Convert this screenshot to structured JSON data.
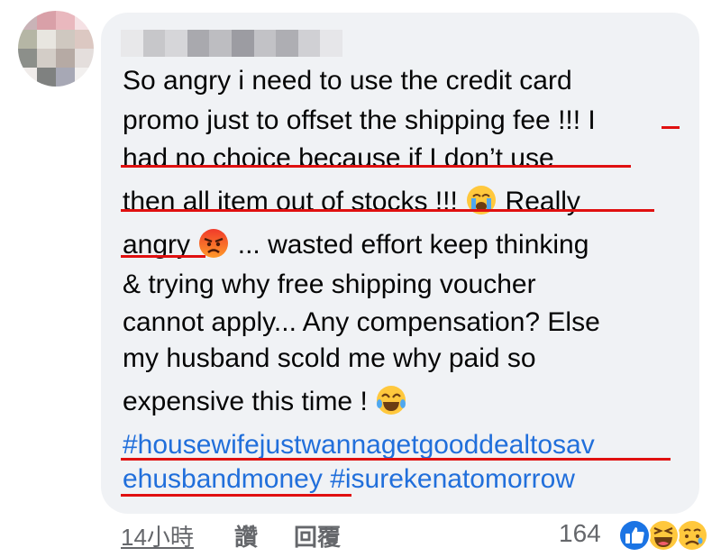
{
  "comment": {
    "lines": [
      "So angry i need to use the credit card",
      "promo just to offset the shipping fee !!! I",
      "had no choice because if I don’t use",
      "then all item out of stocks !!!",
      "Really",
      "angry",
      "... wasted effort keep thinking",
      "& trying why free shipping voucher",
      "cannot apply... Any compensation? Else",
      "my husband scold me why paid so",
      "expensive this time !"
    ],
    "hashtags": {
      "tag1_part1": "#housewifejustwannagetgooddealtosav",
      "tag1_part2": "ehusbandmoney",
      "tag2": "#isurekenatomorrow"
    },
    "emojis": [
      "crying-emoji",
      "angry-emoji",
      "laughing-tears-emoji"
    ]
  },
  "footer": {
    "timestamp": "14小時",
    "like_label": "讚",
    "reply_label": "回覆",
    "reaction_count": "164",
    "reactions": [
      "like-reaction-icon",
      "haha-reaction-icon",
      "sad-reaction-icon"
    ]
  },
  "colors": {
    "bubble": "#f0f2f5",
    "hashtag": "#216fdb",
    "annotation_underline": "#e01010",
    "meta_text": "#65676b"
  }
}
